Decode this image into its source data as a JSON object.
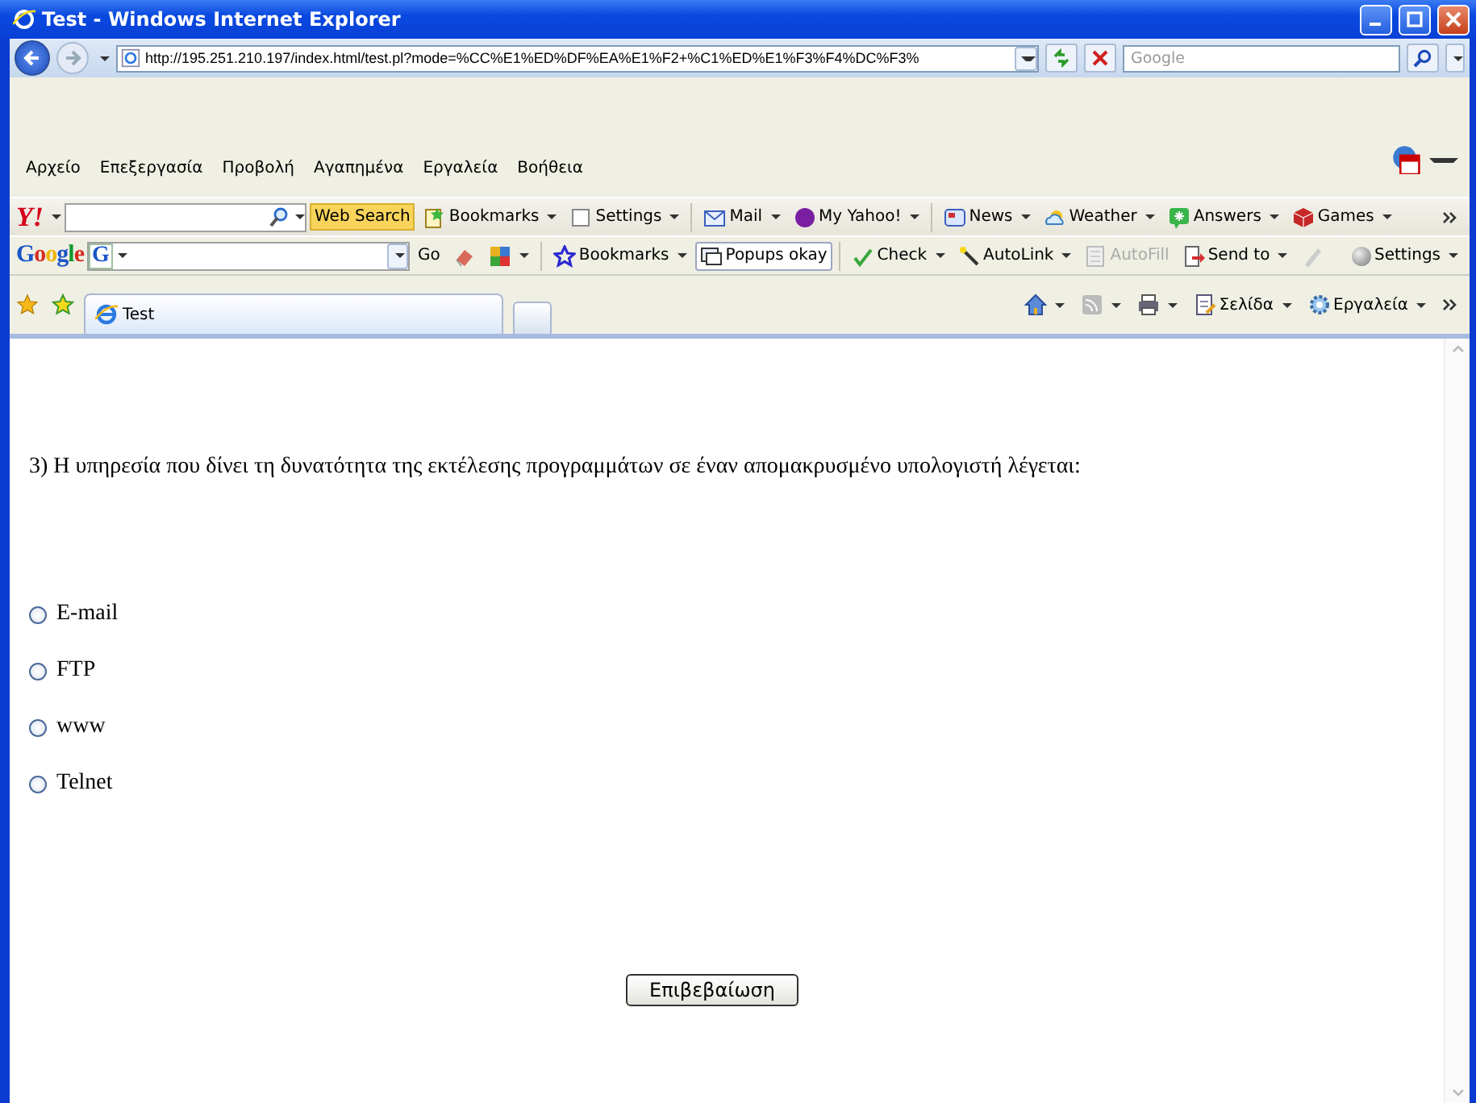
{
  "window": {
    "title": "Test - Windows Internet Explorer"
  },
  "address_bar": {
    "url": "http://195.251.210.197/index.html/test.pl?mode=%CC%E1%ED%DF%EA%E1%F2+%C1%ED%E1%F3%F4%DC%F3%"
  },
  "search": {
    "placeholder": "Google"
  },
  "menu": [
    "Αρχείο",
    "Επεξεργασία",
    "Προβολή",
    "Αγαπημένα",
    "Εργαλεία",
    "Βοήθεια"
  ],
  "yahoo_toolbar": {
    "logo": "Y!",
    "search_button": "Web Search",
    "items": [
      {
        "label": "Bookmarks",
        "dropdown": true
      },
      {
        "label": "Settings",
        "dropdown": true
      },
      {
        "label": "Mail",
        "dropdown": true
      },
      {
        "label": "My Yahoo!",
        "dropdown": true
      },
      {
        "label": "News",
        "dropdown": true
      },
      {
        "label": "Weather",
        "dropdown": true
      },
      {
        "label": "Answers",
        "dropdown": true
      },
      {
        "label": "Games",
        "dropdown": true
      }
    ]
  },
  "google_toolbar": {
    "logo": "Google",
    "g_button": "G",
    "go": "Go",
    "items": [
      {
        "label": "Bookmarks",
        "dropdown": true,
        "disabled": false,
        "pressed": false
      },
      {
        "label": "Popups okay",
        "dropdown": false,
        "disabled": false,
        "pressed": true
      },
      {
        "label": "Check",
        "dropdown": true,
        "disabled": false,
        "pressed": false
      },
      {
        "label": "AutoLink",
        "dropdown": true,
        "disabled": false,
        "pressed": false
      },
      {
        "label": "AutoFill",
        "dropdown": false,
        "disabled": true,
        "pressed": false
      },
      {
        "label": "Send to",
        "dropdown": true,
        "disabled": false,
        "pressed": false
      }
    ],
    "settings": "Settings"
  },
  "tabs": [
    {
      "label": "Test",
      "selected": true
    }
  ],
  "command_bar": [
    {
      "label": "Σελίδα"
    },
    {
      "label": "Εργαλεία"
    }
  ],
  "question": "3) Η υπηρεσία που δίνει τη δυνατότητα της εκτέλεσης προγραμμάτων σε έναν απομακρυσμένο υπολογιστή λέγεται:",
  "options": [
    {
      "label": "E-mail",
      "selected": false
    },
    {
      "label": "FTP",
      "selected": false
    },
    {
      "label": "www",
      "selected": false
    },
    {
      "label": "Telnet",
      "selected": false
    }
  ],
  "submit": "Επιβεβαίωση"
}
